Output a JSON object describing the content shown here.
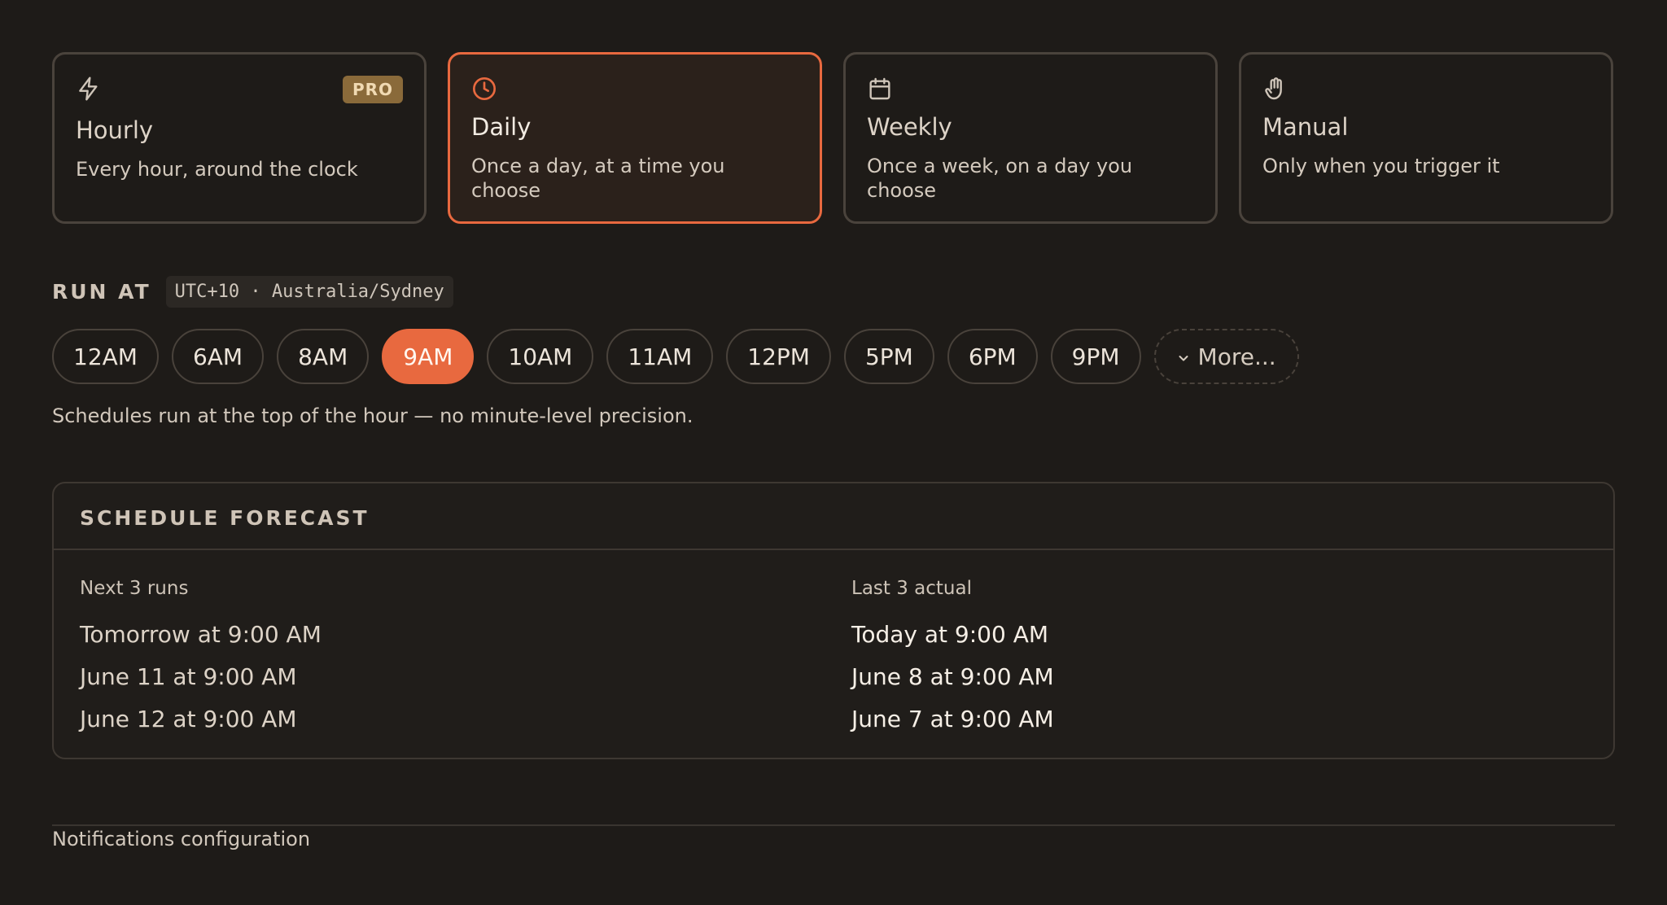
{
  "frequency_cards": [
    {
      "id": "hourly",
      "title": "Hourly",
      "desc": "Every hour, around the clock",
      "badge": "PRO",
      "icon": "lightning-icon",
      "selected": false
    },
    {
      "id": "daily",
      "title": "Daily",
      "desc": "Once a day, at a time you choose",
      "icon": "clock-icon",
      "selected": true
    },
    {
      "id": "weekly",
      "title": "Weekly",
      "desc": "Once a week, on a day you choose",
      "icon": "calendar-icon",
      "selected": false
    },
    {
      "id": "manual",
      "title": "Manual",
      "desc": "Only when you trigger it",
      "icon": "hand-icon",
      "selected": false
    }
  ],
  "run_at": {
    "label": "RUN AT",
    "timezone": "UTC+10 · Australia/Sydney",
    "hours": [
      "12AM",
      "6AM",
      "8AM",
      "9AM",
      "10AM",
      "11AM",
      "12PM",
      "5PM",
      "6PM",
      "9PM"
    ],
    "selected_hour": "9AM",
    "more_label": "More...",
    "hint": "Schedules run at the top of the hour — no minute-level precision."
  },
  "forecast": {
    "title": "SCHEDULE FORECAST",
    "next_label": "Next 3 runs",
    "next": [
      "Tomorrow at 9:00 AM",
      "June 11 at 9:00 AM",
      "June 12 at 9:00 AM"
    ],
    "last_label": "Last 3 actual",
    "last": [
      "Today at 9:00 AM",
      "June 8 at 9:00 AM",
      "June 7 at 9:00 AM"
    ]
  },
  "footer": {
    "link": "Notifications configuration"
  },
  "colors": {
    "accent": "#e8693f",
    "background": "#1e1b18",
    "pro_badge": "#8a6a3a"
  }
}
